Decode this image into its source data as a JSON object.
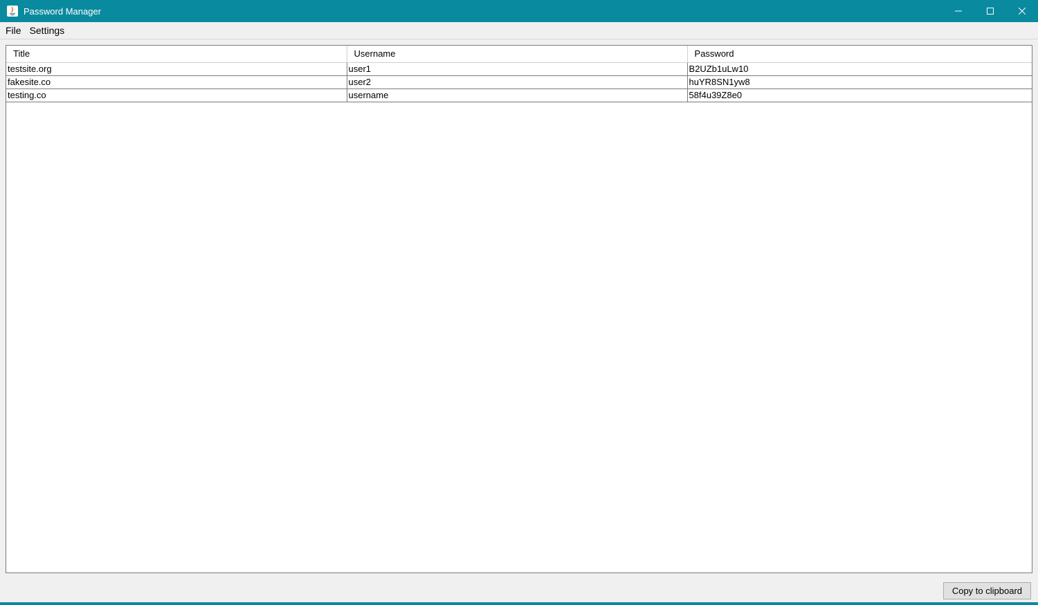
{
  "window": {
    "title": "Password Manager"
  },
  "menubar": {
    "file": "File",
    "settings": "Settings"
  },
  "table": {
    "headers": {
      "title": "Title",
      "username": "Username",
      "password": "Password"
    },
    "rows": [
      {
        "title": "testsite.org",
        "username": "user1",
        "password": "B2UZb1uLw10"
      },
      {
        "title": "fakesite.co",
        "username": "user2",
        "password": "huYR8SN1yw8"
      },
      {
        "title": "testing.co",
        "username": "username",
        "password": "58f4u39Z8e0"
      }
    ]
  },
  "actions": {
    "copy": "Copy to clipboard"
  }
}
